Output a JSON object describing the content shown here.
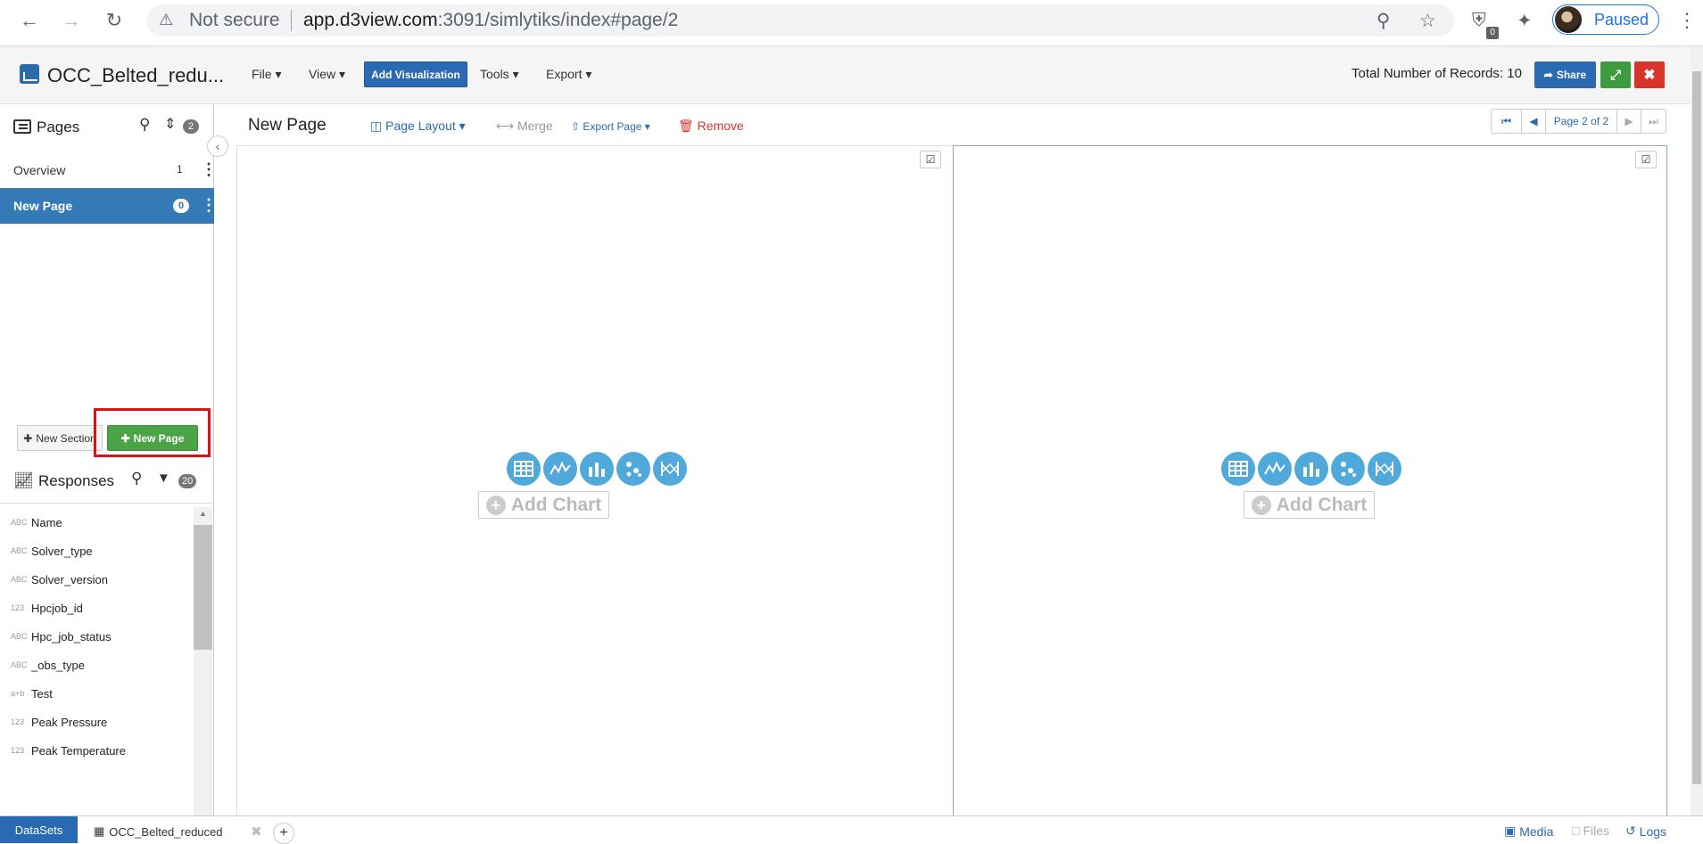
{
  "browser": {
    "security_label": "Not secure",
    "url_host": "app.d3view.com",
    "url_path": ":3091/simlytiks/index#page/2",
    "extension_badge": "0",
    "profile_label": "Paused"
  },
  "header": {
    "app_title": "OCC_Belted_redu...",
    "menus": [
      "File",
      "View",
      "Tools",
      "Export"
    ],
    "add_visualization": "Add Visualization",
    "records": "Total Number of Records: 10",
    "share": "Share"
  },
  "sidebar": {
    "pages_title": "Pages",
    "pages_count": "2",
    "pages": [
      {
        "label": "Overview",
        "count": "1"
      },
      {
        "label": "New Page",
        "count": "0"
      }
    ],
    "new_section": "New Section",
    "new_page": "New Page",
    "responses_title": "Responses",
    "responses_count": "20",
    "fields": [
      {
        "type": "ABC",
        "name": "Name"
      },
      {
        "type": "ABC",
        "name": "Solver_type"
      },
      {
        "type": "ABC",
        "name": "Solver_version"
      },
      {
        "type": "123",
        "name": "Hpcjob_id"
      },
      {
        "type": "ABC",
        "name": "Hpc_job_status"
      },
      {
        "type": "ABC",
        "name": "_obs_type"
      },
      {
        "type": "a+b",
        "name": "Test"
      },
      {
        "type": "123",
        "name": "Peak Pressure"
      },
      {
        "type": "123",
        "name": "Peak Temperature"
      }
    ]
  },
  "main": {
    "page_name": "New Page",
    "page_layout": "Page Layout",
    "merge": "Merge",
    "export_page": "Export Page",
    "remove": "Remove",
    "pager_label": "Page 2 of 2",
    "add_chart": "Add Chart"
  },
  "footer": {
    "datasets": "DataSets",
    "file_tab": "OCC_Belted_reduced",
    "media": "Media",
    "files": "Files",
    "logs": "Logs"
  },
  "colors": {
    "primary": "#2a6ab2",
    "success": "#4aa344",
    "danger": "#d9342b",
    "chart_icon": "#4fa9db",
    "highlight": "#e01010"
  }
}
